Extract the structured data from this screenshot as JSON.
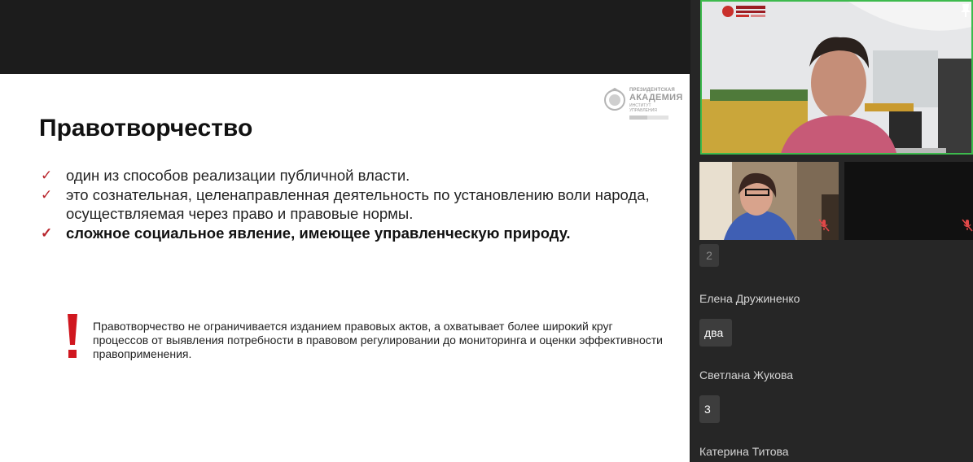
{
  "slide": {
    "logo": {
      "line1": "ПРЕЗИДЕНТСКАЯ",
      "line2": "АКАДЕМИЯ",
      "line3": "ИНСТИТУТ УПРАВЛЕНИЯ"
    },
    "title": "Правотворчество",
    "bullets": [
      {
        "text": "один из способов реализации публичной власти.",
        "bold": false
      },
      {
        "text": "это сознательная, целенаправленная деятельность по установлению воли народа, осуществляемая через право и правовые нормы.",
        "bold": false
      },
      {
        "text": "сложное социальное явление, имеющее управленческую природу.",
        "bold": true
      }
    ],
    "check_glyph": "✓",
    "note": "Правотворчество не ограничивается изданием правовых актов, а охватывает более широкий круг процессов от выявления потребности в правовом регулировании до мониторинга и оценки эффективности правоприменения.",
    "accent_color": "#b8252c"
  },
  "video": {
    "active_speaker_border": "#3dba4d"
  },
  "chat": {
    "partial_badge": "2",
    "messages": [
      {
        "author": "Елена Дружиненко",
        "text": "два"
      },
      {
        "author": "Светлана Жукова",
        "text": "3"
      },
      {
        "author": "Катерина Титова",
        "text": ""
      }
    ]
  }
}
